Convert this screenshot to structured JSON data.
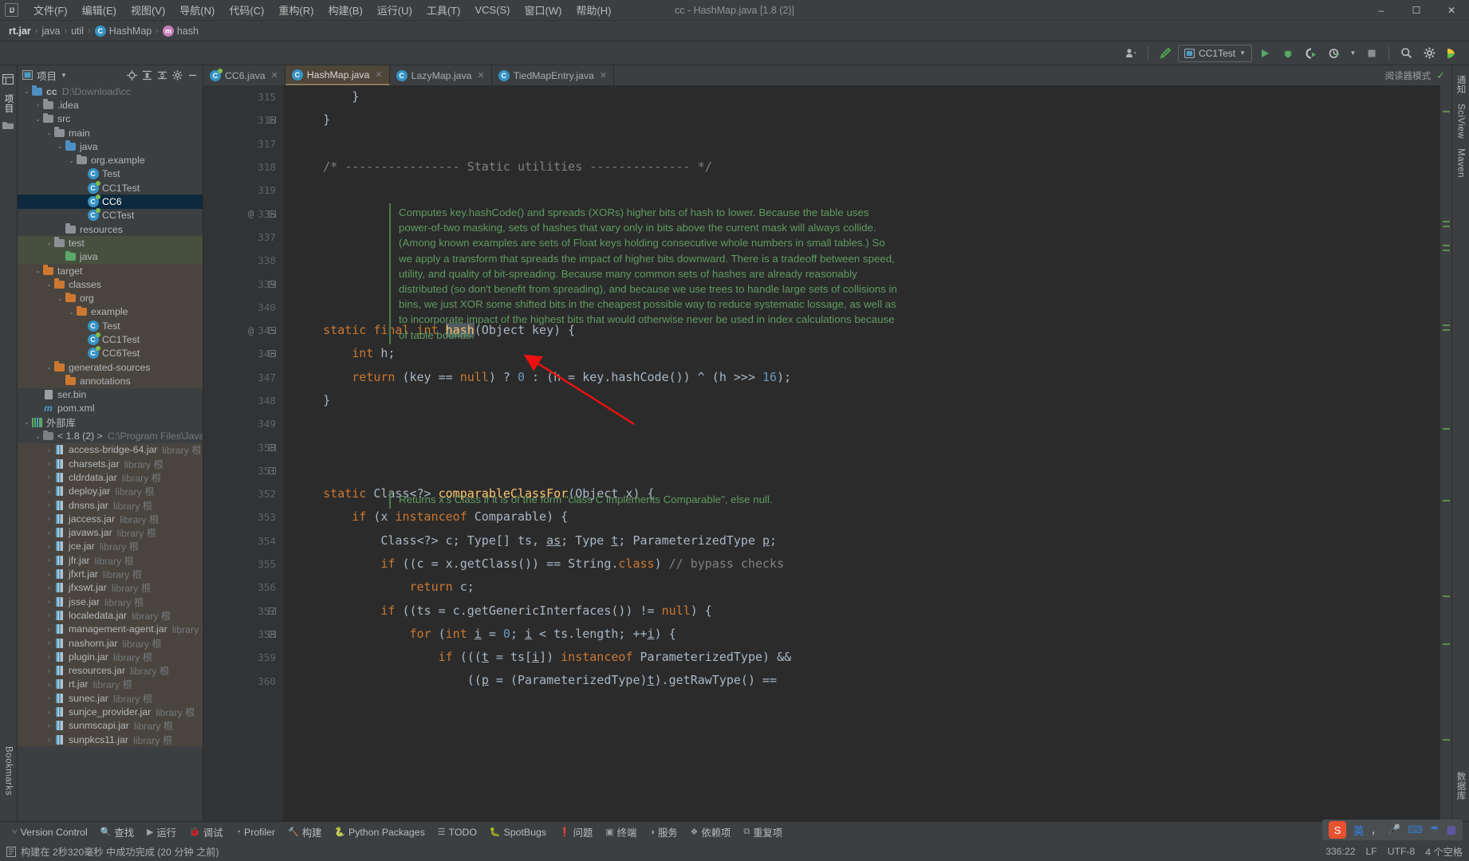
{
  "window": {
    "app_icon": "IJ",
    "title": "cc - HashMap.java [1.8 (2)]",
    "minimize": "–",
    "maximize": "☐",
    "close": "✕"
  },
  "menu": [
    {
      "label": "文件(F)"
    },
    {
      "label": "编辑(E)"
    },
    {
      "label": "视图(V)"
    },
    {
      "label": "导航(N)"
    },
    {
      "label": "代码(C)"
    },
    {
      "label": "重构(R)"
    },
    {
      "label": "构建(B)"
    },
    {
      "label": "运行(U)"
    },
    {
      "label": "工具(T)"
    },
    {
      "label": "VCS(S)"
    },
    {
      "label": "窗口(W)"
    },
    {
      "label": "帮助(H)"
    }
  ],
  "breadcrumb": {
    "items": [
      {
        "label": "rt.jar",
        "icon": "jar-icon",
        "bold": true
      },
      {
        "label": "java",
        "icon": "package-icon"
      },
      {
        "label": "util",
        "icon": "package-icon"
      },
      {
        "label": "HashMap",
        "icon": "class-icon"
      },
      {
        "label": "hash",
        "icon": "method-icon"
      }
    ],
    "separator": "›"
  },
  "toolbar": {
    "user_icon": "user-avatar-icon",
    "build_icon": "hammer-icon",
    "run_config": "CC1Test",
    "run_config_icon": "run-config-icon",
    "run": "run-icon",
    "debug": "debug-bug-icon",
    "run_coverage": "run-with-coverage-icon",
    "profile": "profiler-icon",
    "stop": "stop-icon",
    "search": "search-icon",
    "settings": "gear-icon",
    "updates": "updates-icon"
  },
  "left_strip": {
    "project_label": "项目",
    "bookmarks_label": "Bookmarks"
  },
  "right_strip": {
    "items": [
      "Notifications",
      "Maven",
      "SciView",
      "数据库"
    ]
  },
  "project_panel": {
    "title": "项目",
    "dropdown_icon": "chevron-down-icon",
    "actions": [
      "locate-icon",
      "expand-all-icon",
      "collapse-all-icon",
      "gear-icon",
      "hide-icon"
    ],
    "tree": [
      {
        "depth": 0,
        "arrow": "⌄",
        "icon": "project-folder",
        "label": "cc",
        "suffix": "D:\\Download\\cc",
        "bold": true,
        "state": "normal"
      },
      {
        "depth": 1,
        "arrow": "›",
        "icon": "folder-grey",
        "label": ".idea",
        "state": "normal"
      },
      {
        "depth": 1,
        "arrow": "⌄",
        "icon": "folder-grey",
        "label": "src",
        "state": "normal"
      },
      {
        "depth": 2,
        "arrow": "⌄",
        "icon": "folder-grey",
        "label": "main",
        "state": "normal"
      },
      {
        "depth": 3,
        "arrow": "⌄",
        "icon": "folder-blue",
        "label": "java",
        "state": "normal"
      },
      {
        "depth": 4,
        "arrow": "⌄",
        "icon": "package-folder",
        "label": "org.example",
        "state": "normal"
      },
      {
        "depth": 5,
        "arrow": "",
        "icon": "class-icon",
        "label": "Test",
        "state": "normal"
      },
      {
        "depth": 5,
        "arrow": "",
        "icon": "class-run-icon",
        "label": "CC1Test",
        "state": "normal"
      },
      {
        "depth": 5,
        "arrow": "",
        "icon": "class-run-icon",
        "label": "CC6",
        "state": "selected"
      },
      {
        "depth": 5,
        "arrow": "",
        "icon": "class-run-icon",
        "label": "CCTest",
        "state": "normal"
      },
      {
        "depth": 3,
        "arrow": "",
        "icon": "resources-folder",
        "label": "resources",
        "state": "normal"
      },
      {
        "depth": 2,
        "arrow": "⌄",
        "icon": "folder-grey",
        "label": "test",
        "state": "srcroot"
      },
      {
        "depth": 3,
        "arrow": "",
        "icon": "folder-green",
        "label": "java",
        "state": "srcroot"
      },
      {
        "depth": 1,
        "arrow": "⌄",
        "icon": "folder-orange",
        "label": "target",
        "state": "excluded"
      },
      {
        "depth": 2,
        "arrow": "⌄",
        "icon": "folder-orange",
        "label": "classes",
        "state": "excluded"
      },
      {
        "depth": 3,
        "arrow": "⌄",
        "icon": "folder-orange",
        "label": "org",
        "state": "excluded"
      },
      {
        "depth": 4,
        "arrow": "⌄",
        "icon": "folder-orange",
        "label": "example",
        "state": "excluded"
      },
      {
        "depth": 5,
        "arrow": "",
        "icon": "class-icon",
        "label": "Test",
        "state": "excluded"
      },
      {
        "depth": 5,
        "arrow": "",
        "icon": "class-run-icon",
        "label": "CC1Test",
        "state": "excluded"
      },
      {
        "depth": 5,
        "arrow": "",
        "icon": "class-run-icon",
        "label": "CC6Test",
        "state": "excluded"
      },
      {
        "depth": 2,
        "arrow": "⌄",
        "icon": "folder-orange",
        "label": "generated-sources",
        "state": "excluded"
      },
      {
        "depth": 3,
        "arrow": "",
        "icon": "folder-orange",
        "label": "annotations",
        "state": "excluded"
      },
      {
        "depth": 1,
        "arrow": "",
        "icon": "bin-file-icon",
        "label": "ser.bin",
        "state": "normal"
      },
      {
        "depth": 1,
        "arrow": "",
        "icon": "maven-file-icon",
        "label": "pom.xml",
        "state": "normal"
      },
      {
        "depth": 0,
        "arrow": "⌄",
        "icon": "library-icon",
        "label": "外部库",
        "state": "normal"
      },
      {
        "depth": 1,
        "arrow": "⌄",
        "icon": "jdk-icon",
        "label": "< 1.8 (2) >",
        "suffix": "C:\\Program Files\\Java\\jdk",
        "state": "normal"
      },
      {
        "depth": 2,
        "arrow": "›",
        "icon": "jar-icon",
        "label": "access-bridge-64.jar",
        "suffix": "library 根",
        "state": "excluded"
      },
      {
        "depth": 2,
        "arrow": "›",
        "icon": "jar-icon",
        "label": "charsets.jar",
        "suffix": "library 根",
        "state": "excluded"
      },
      {
        "depth": 2,
        "arrow": "›",
        "icon": "jar-icon",
        "label": "cldrdata.jar",
        "suffix": "library 根",
        "state": "excluded"
      },
      {
        "depth": 2,
        "arrow": "›",
        "icon": "jar-icon",
        "label": "deploy.jar",
        "suffix": "library 根",
        "state": "excluded"
      },
      {
        "depth": 2,
        "arrow": "›",
        "icon": "jar-icon",
        "label": "dnsns.jar",
        "suffix": "library 根",
        "state": "excluded"
      },
      {
        "depth": 2,
        "arrow": "›",
        "icon": "jar-icon",
        "label": "jaccess.jar",
        "suffix": "library 根",
        "state": "excluded"
      },
      {
        "depth": 2,
        "arrow": "›",
        "icon": "jar-icon",
        "label": "javaws.jar",
        "suffix": "library 根",
        "state": "excluded"
      },
      {
        "depth": 2,
        "arrow": "›",
        "icon": "jar-icon",
        "label": "jce.jar",
        "suffix": "library 根",
        "state": "excluded"
      },
      {
        "depth": 2,
        "arrow": "›",
        "icon": "jar-icon",
        "label": "jfr.jar",
        "suffix": "library 根",
        "state": "excluded"
      },
      {
        "depth": 2,
        "arrow": "›",
        "icon": "jar-icon",
        "label": "jfxrt.jar",
        "suffix": "library 根",
        "state": "excluded"
      },
      {
        "depth": 2,
        "arrow": "›",
        "icon": "jar-icon",
        "label": "jfxswt.jar",
        "suffix": "library 根",
        "state": "excluded"
      },
      {
        "depth": 2,
        "arrow": "›",
        "icon": "jar-icon",
        "label": "jsse.jar",
        "suffix": "library 根",
        "state": "excluded"
      },
      {
        "depth": 2,
        "arrow": "›",
        "icon": "jar-icon",
        "label": "localedata.jar",
        "suffix": "library 根",
        "state": "excluded"
      },
      {
        "depth": 2,
        "arrow": "›",
        "icon": "jar-icon",
        "label": "management-agent.jar",
        "suffix": "library 根",
        "state": "excluded"
      },
      {
        "depth": 2,
        "arrow": "›",
        "icon": "jar-icon",
        "label": "nashorn.jar",
        "suffix": "library 根",
        "state": "excluded"
      },
      {
        "depth": 2,
        "arrow": "›",
        "icon": "jar-icon",
        "label": "plugin.jar",
        "suffix": "library 根",
        "state": "excluded"
      },
      {
        "depth": 2,
        "arrow": "›",
        "icon": "jar-icon",
        "label": "resources.jar",
        "suffix": "library 根",
        "state": "excluded"
      },
      {
        "depth": 2,
        "arrow": "›",
        "icon": "jar-icon",
        "label": "rt.jar",
        "suffix": "library 根",
        "state": "excluded"
      },
      {
        "depth": 2,
        "arrow": "›",
        "icon": "jar-icon",
        "label": "sunec.jar",
        "suffix": "library 根",
        "state": "excluded"
      },
      {
        "depth": 2,
        "arrow": "›",
        "icon": "jar-icon",
        "label": "sunjce_provider.jar",
        "suffix": "library 根",
        "state": "excluded"
      },
      {
        "depth": 2,
        "arrow": "›",
        "icon": "jar-icon",
        "label": "sunmscapi.jar",
        "suffix": "library 根",
        "state": "excluded"
      },
      {
        "depth": 2,
        "arrow": "›",
        "icon": "jar-icon",
        "label": "sunpkcs11.jar",
        "suffix": "library 根",
        "state": "excluded"
      }
    ]
  },
  "editor": {
    "tabs": [
      {
        "label": "CC6.java",
        "icon": "class-run-icon",
        "active": false,
        "close": "✕"
      },
      {
        "label": "HashMap.java",
        "icon": "class-icon",
        "active": true,
        "close": "✕"
      },
      {
        "label": "LazyMap.java",
        "icon": "class-icon",
        "active": false,
        "close": "✕"
      },
      {
        "label": "TiedMapEntry.java",
        "icon": "class-icon",
        "active": false,
        "close": "✕"
      }
    ],
    "reader_mode": "阅读器模式",
    "reader_check": "✓",
    "line_numbers": [
      "315",
      "316",
      "317",
      "318",
      "319",
      "336",
      "337",
      "338",
      "339",
      "340",
      "345",
      "346",
      "347",
      "348",
      "349",
      "350",
      "351",
      "352",
      "353",
      "354",
      "355",
      "356",
      "357",
      "358",
      "359",
      "360"
    ],
    "javadoc_1": "Computes key.hashCode() and spreads (XORs) higher bits of hash to lower. Because the table uses power-of-two masking, sets of hashes that vary only in bits above the current mask will always collide. (Among known examples are sets of Float keys holding consecutive whole numbers in small tables.) So we apply a transform that spreads the impact of higher bits downward. There is a tradeoff between speed, utility, and quality of bit-spreading. Because many common sets of hashes are already reasonably distributed (so don't benefit from spreading), and because we use trees to handle large sets of collisions in bins, we just XOR some shifted bits in the cheapest possible way to reduce systematic lossage, as well as to incorporate impact of the highest bits that would otherwise never be used in index calculations because of table bounds.",
    "javadoc_2": "Returns x's Class if it is of the form \"class C implements Comparable\", else null.",
    "annotation_marker": "@"
  },
  "bottom_bar": [
    {
      "label": "Version Control",
      "icon": "branch-icon"
    },
    {
      "label": "查找",
      "icon": "search-icon"
    },
    {
      "label": "运行",
      "icon": "run-icon"
    },
    {
      "label": "调试",
      "icon": "debug-icon"
    },
    {
      "label": "Profiler",
      "icon": "profiler-icon"
    },
    {
      "label": "构建",
      "icon": "hammer-icon"
    },
    {
      "label": "Python Packages",
      "icon": "python-icon"
    },
    {
      "label": "TODO",
      "icon": "todo-icon"
    },
    {
      "label": "SpotBugs",
      "icon": "spotbugs-icon"
    },
    {
      "label": "问题",
      "icon": "problems-icon"
    },
    {
      "label": "终端",
      "icon": "terminal-icon"
    },
    {
      "label": "服务",
      "icon": "services-icon"
    },
    {
      "label": "依赖项",
      "icon": "dependencies-icon"
    },
    {
      "label": "重复项",
      "icon": "duplicates-icon"
    }
  ],
  "status_bar": {
    "message_icon": "build-status-icon",
    "message": "构建在 2秒320毫秒 中成功完成 (20 分钟 之前)",
    "caret_position": "336:22",
    "line_separator": "LF",
    "encoding": "UTF-8",
    "indent": "4 个空格"
  },
  "ime_bar": {
    "logo": "sogou-icon",
    "mode": "英",
    "punctuation": "，",
    "mic": "mic-icon",
    "keyboard": "keyboard-icon",
    "umbrella": "umbrella-icon",
    "apps": "apps-icon"
  },
  "colors": {
    "bg": "#2b2b2b",
    "panel": "#3c3f41",
    "selection": "#0d293e",
    "keyword": "#cc7832",
    "string": "#6a8759",
    "number": "#6897bb",
    "method": "#ffc66d",
    "javadoc": "#629755",
    "field": "#9876aa",
    "arrow_annotation": "#ee1111",
    "src_root": "#4f5b3d",
    "excluded": "#5d513a"
  }
}
